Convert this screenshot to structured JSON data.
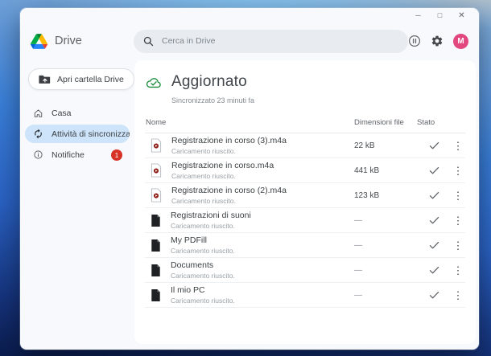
{
  "window": {
    "controls": {
      "minimize": "─",
      "maximize": "□",
      "close": "✕"
    },
    "header": {
      "app_name": "Drive",
      "search_placeholder": "Cerca in Drive",
      "avatar_letter": "M"
    },
    "sidebar": {
      "open_folder_button": "Apri cartella Drive",
      "items": [
        {
          "label": "Casa",
          "icon": "home-icon",
          "selected": false
        },
        {
          "label": "Attività di sincronizzazio...",
          "icon": "sync-icon",
          "selected": true
        },
        {
          "label": "Notifiche",
          "icon": "info-icon",
          "selected": false,
          "badge": "1"
        }
      ]
    },
    "main": {
      "status_title": "Aggiornato",
      "status_subtitle": "Sincronizzato 23 minuti fa",
      "table": {
        "columns": [
          "Nome",
          "Dimensioni file",
          "Stato"
        ],
        "rows": [
          {
            "name": "Registrazione in corso (3).m4a",
            "status_text": "Caricamento riuscito.",
            "size": "22 kB",
            "type": "audio",
            "status": "synced"
          },
          {
            "name": "Registrazione in corso.m4a",
            "status_text": "Caricamento riuscito.",
            "size": "441 kB",
            "type": "audio",
            "status": "synced"
          },
          {
            "name": "Registrazione in corso (2).m4a",
            "status_text": "Caricamento riuscito.",
            "size": "123 kB",
            "type": "audio",
            "status": "synced"
          },
          {
            "name": "Registrazioni di suoni",
            "status_text": "Caricamento riuscito.",
            "size": "—",
            "type": "file",
            "status": "synced"
          },
          {
            "name": "My PDFill",
            "status_text": "Caricamento riuscito.",
            "size": "—",
            "type": "file",
            "status": "synced"
          },
          {
            "name": "Documents",
            "status_text": "Caricamento riuscito.",
            "size": "—",
            "type": "file",
            "status": "synced"
          },
          {
            "name": "Il mio PC",
            "status_text": "Caricamento riuscito.",
            "size": "—",
            "type": "file",
            "status": "synced"
          }
        ]
      }
    }
  },
  "icons": {
    "kebab": "⋮"
  },
  "colors": {
    "selected_pill": "#cde4fb",
    "badge_red": "#d73226",
    "avatar_pink": "#e2477e",
    "cloud_green": "#1e8e3e",
    "check_gray": "#5f6368",
    "audio_icon_red": "#8f1d18",
    "window_bg": "#f7f9fc",
    "search_bg": "#e8ecf0"
  }
}
